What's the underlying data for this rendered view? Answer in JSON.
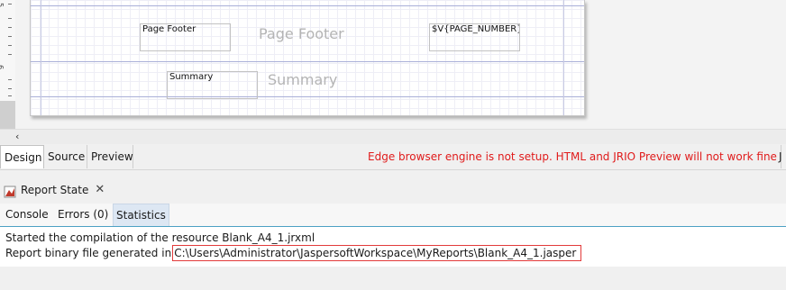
{
  "ruler": {
    "numbers": [
      "5",
      "6"
    ]
  },
  "design": {
    "bands": [
      {
        "title": "Page Footer",
        "label": "Page Footer",
        "field": "$V{PAGE_NUMBER}"
      },
      {
        "title": "Summary",
        "label": "Summary"
      }
    ]
  },
  "scroll": {
    "left_arrow": "‹"
  },
  "editor_tabs": [
    {
      "label": "Design",
      "active": true
    },
    {
      "label": "Source",
      "active": false
    },
    {
      "label": "Preview",
      "active": false
    }
  ],
  "warning": {
    "text": "Edge browser engine is not setup. HTML and JRIO Preview will not work fine",
    "color": "#e01b1b",
    "overflow_text": "J"
  },
  "view": {
    "title": "Report State",
    "close_icon": "close-icon",
    "icon": "report-state-icon",
    "subtabs": [
      {
        "label": "Console",
        "active": false
      },
      {
        "label": "Errors (0)",
        "active": false
      },
      {
        "label": "Statistics",
        "active": true
      }
    ]
  },
  "console": {
    "line1": "Started the compilation of the resource Blank_A4_1.jrxml",
    "line2_prefix": "Report binary file generated in",
    "line2_path": "C:\\Users\\Administrator\\JaspersoftWorkspace\\MyReports\\Blank_A4_1.jasper",
    "highlight_color": "#e23a3a"
  }
}
